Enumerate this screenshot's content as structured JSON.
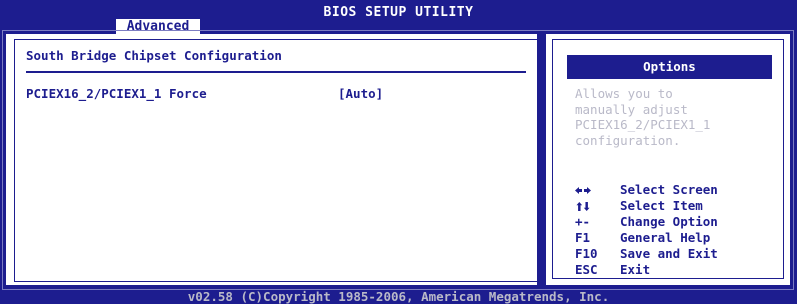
{
  "header": {
    "title": "BIOS SETUP UTILITY",
    "active_tab": "Advanced"
  },
  "left": {
    "heading": "South Bridge Chipset Configuration",
    "items": [
      {
        "label": "PCIEX16_2/PCIEX1_1 Force",
        "value": "[Auto]"
      }
    ]
  },
  "right": {
    "options_title": "Options",
    "help_text": "Allows you to\nmanually adjust\nPCIEX16_2/PCIEX1_1\nconfiguration.",
    "keys": [
      {
        "key": "",
        "icon": "left-right-arrows-icon",
        "desc": "Select Screen"
      },
      {
        "key": "",
        "icon": "up-down-arrows-icon",
        "desc": "Select Item"
      },
      {
        "key": "+-",
        "desc": "Change Option"
      },
      {
        "key": "F1",
        "desc": "General Help"
      },
      {
        "key": "F10",
        "desc": "Save and Exit"
      },
      {
        "key": "ESC",
        "desc": "Exit"
      }
    ]
  },
  "footer": {
    "copyright": "v02.58 (C)Copyright 1985-2006, American Megatrends, Inc."
  },
  "colors": {
    "background": "#1d1d8f",
    "panel": "#ffffff",
    "dim_text": "#b9b9c8"
  }
}
